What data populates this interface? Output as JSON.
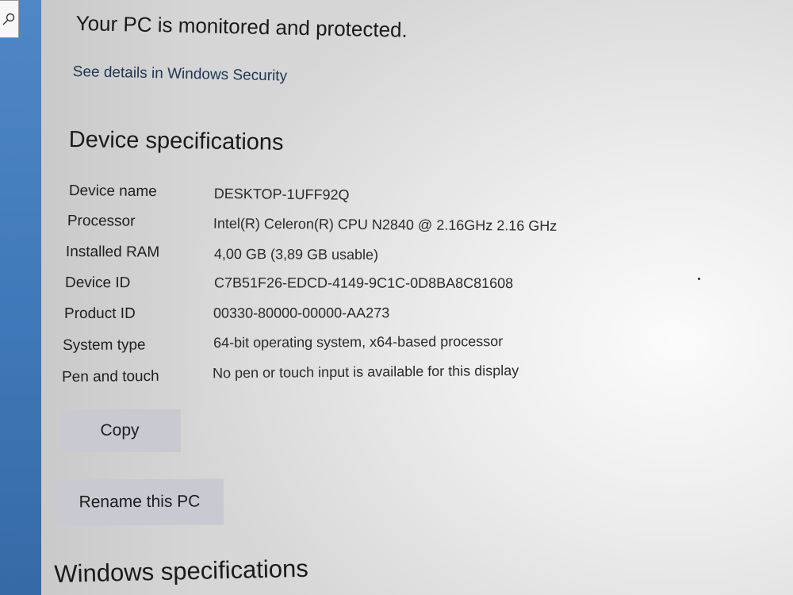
{
  "security": {
    "status_text": "Your PC is monitored and protected.",
    "link_label": "See details in Windows Security"
  },
  "device_specs": {
    "title": "Device specifications",
    "rows": [
      {
        "label": "Device name",
        "value": "DESKTOP-1UFF92Q"
      },
      {
        "label": "Processor",
        "value": "Intel(R) Celeron(R) CPU  N2840  @ 2.16GHz   2.16 GHz"
      },
      {
        "label": "Installed RAM",
        "value": "4,00 GB (3,89 GB usable)"
      },
      {
        "label": "Device ID",
        "value": "C7B51F26-EDCD-4149-9C1C-0D8BA8C81608"
      },
      {
        "label": "Product ID",
        "value": "00330-80000-00000-AA273"
      },
      {
        "label": "System type",
        "value": "64-bit operating system, x64-based processor"
      },
      {
        "label": "Pen and touch",
        "value": "No pen or touch input is available for this display"
      }
    ],
    "copy_label": "Copy",
    "rename_label": "Rename this PC"
  },
  "windows_specs": {
    "title": "Windows specifications"
  },
  "icons": {
    "search": "search-icon"
  },
  "colors": {
    "sidebar_accent": "#3f78b8",
    "button_background": "#c9c9d1"
  }
}
